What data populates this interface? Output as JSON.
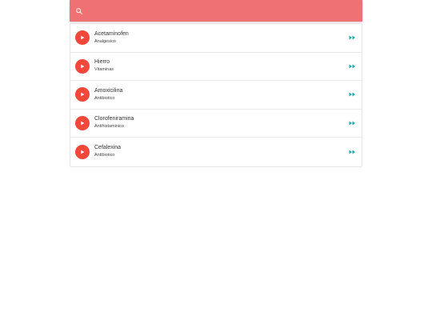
{
  "search": {
    "icon": "search-icon",
    "placeholder": "",
    "value": "",
    "bar_color": "#f07173"
  },
  "colors": {
    "avatar": "#f2473b",
    "action": "#26a6a0"
  },
  "items": [
    {
      "name": "Acetaminofen",
      "category": "Analgesico",
      "icon": "play-icon",
      "action_icon": "fast-forward-icon"
    },
    {
      "name": "Hierro",
      "category": "Vitaminas",
      "icon": "play-icon",
      "action_icon": "fast-forward-icon"
    },
    {
      "name": "Amoxicilina",
      "category": "Antibiotico",
      "icon": "play-icon",
      "action_icon": "fast-forward-icon"
    },
    {
      "name": "Clorofeniramina",
      "category": "Antihistaminico",
      "icon": "play-icon",
      "action_icon": "fast-forward-icon"
    },
    {
      "name": "Cefalexina",
      "category": "Antibiotico",
      "icon": "play-icon",
      "action_icon": "fast-forward-icon"
    }
  ]
}
